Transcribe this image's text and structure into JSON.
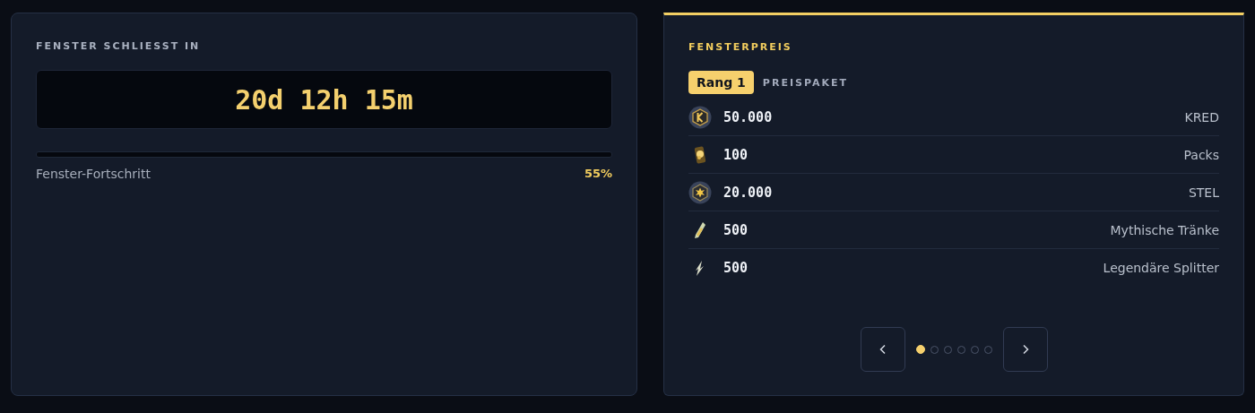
{
  "timer_card": {
    "title": "FENSTER SCHLIESST IN",
    "countdown": "20d 12h 15m",
    "progress_label": "Fenster-Fortschritt",
    "progress_value": "55%"
  },
  "prize_card": {
    "title": "FENSTERPREIS",
    "rank_badge": "Rang 1",
    "package_label": "PREISPAKET",
    "rewards": [
      {
        "kind": "coin",
        "amount": "50.000",
        "name": "KRED"
      },
      {
        "kind": "pack",
        "amount": "100",
        "name": "Packs"
      },
      {
        "kind": "star",
        "amount": "20.000",
        "name": "STEL"
      },
      {
        "kind": "potion",
        "amount": "500",
        "name": "Mythische Tränke"
      },
      {
        "kind": "shard",
        "amount": "500",
        "name": "Legendäre Splitter"
      }
    ],
    "pages": [
      {
        "selected": true
      },
      {
        "selected": false
      },
      {
        "selected": false
      },
      {
        "selected": false
      },
      {
        "selected": false
      },
      {
        "selected": false
      }
    ]
  }
}
